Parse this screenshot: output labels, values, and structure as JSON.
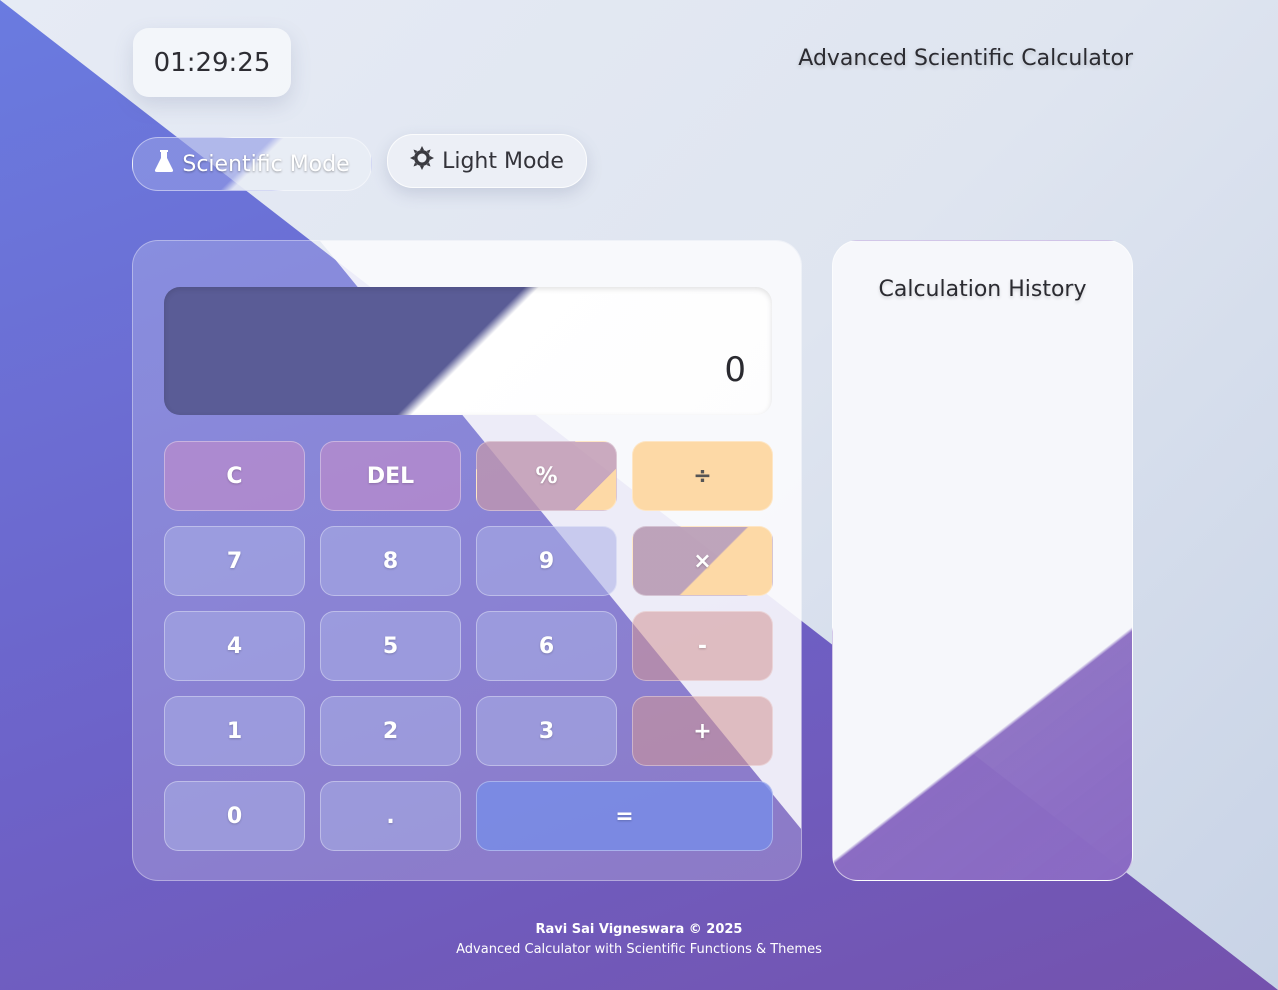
{
  "clock": "01:29:25",
  "app_title": "Advanced Scientific Calculator",
  "mode_buttons": {
    "scientific": {
      "label": "Scientific Mode",
      "icon": "flask-icon"
    },
    "theme": {
      "label": "Light Mode",
      "icon": "sun-icon"
    }
  },
  "display": {
    "value": "0"
  },
  "keys": {
    "clear": "C",
    "delete": "DEL",
    "percent": "%",
    "divide": "÷",
    "seven": "7",
    "eight": "8",
    "nine": "9",
    "multiply": "×",
    "four": "4",
    "five": "5",
    "six": "6",
    "subtract": "-",
    "one": "1",
    "two": "2",
    "three": "3",
    "add": "+",
    "zero": "0",
    "decimal": ".",
    "equals": "="
  },
  "history": {
    "title": "Calculation History"
  },
  "footer": {
    "credit": "Ravi Sai Vigneswara © 2025",
    "tagline": "Advanced Calculator with Scientific Functions & Themes"
  },
  "colors": {
    "accent_purple": "#6d62c8",
    "operator_orange": "#fdd9a6",
    "equals_blue": "#788ce6"
  }
}
